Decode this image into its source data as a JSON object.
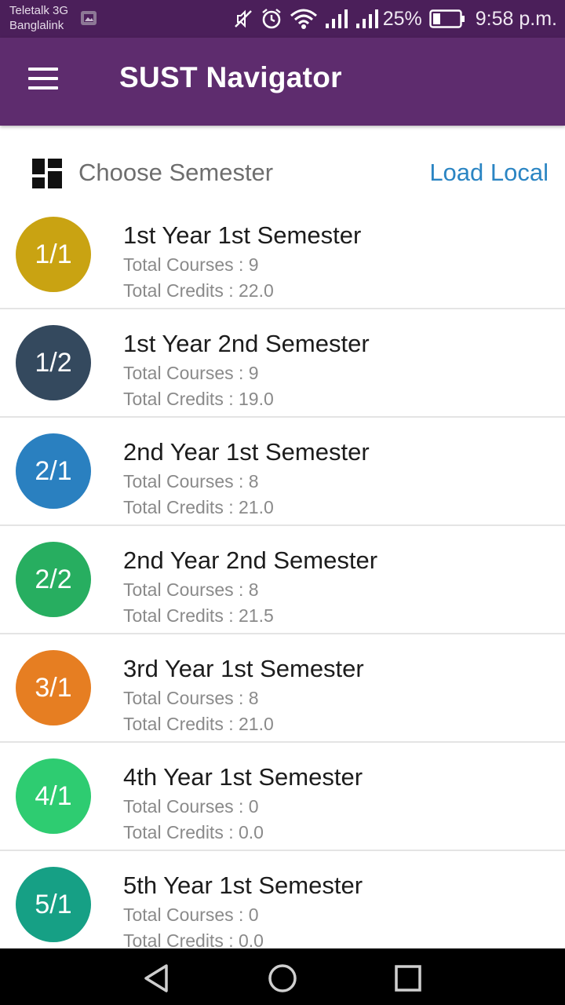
{
  "status_bar": {
    "carrier_1": "Teletalk 3G",
    "carrier_2": "Banglalink",
    "battery_percent": "25%",
    "time": "9:58 p.m.",
    "icons": [
      "gallery-icon",
      "mute-icon",
      "alarm-icon",
      "wifi-icon",
      "signal-icon",
      "signal-icon",
      "battery-icon"
    ]
  },
  "app_bar": {
    "title": "SUST Navigator",
    "background": "#5e2c6e",
    "menu_icon": "hamburger-menu-icon"
  },
  "header": {
    "icon": "dashboard-icon",
    "label": "Choose Semester",
    "action": "Load Local",
    "action_color": "#2b85c3"
  },
  "semesters": [
    {
      "badge": "1/1",
      "color": "#c9a312",
      "title": "1st Year 1st Semester",
      "courses": "Total Courses : 9",
      "credits": "Total Credits : 22.0"
    },
    {
      "badge": "1/2",
      "color": "#34495e",
      "title": "1st Year 2nd Semester",
      "courses": "Total Courses : 9",
      "credits": "Total Credits : 19.0"
    },
    {
      "badge": "2/1",
      "color": "#2a80c0",
      "title": "2nd Year 1st Semester",
      "courses": "Total Courses : 8",
      "credits": "Total Credits : 21.0"
    },
    {
      "badge": "2/2",
      "color": "#27ae60",
      "title": "2nd Year 2nd Semester",
      "courses": "Total Courses : 8",
      "credits": "Total Credits : 21.5"
    },
    {
      "badge": "3/1",
      "color": "#e67e22",
      "title": "3rd Year 1st Semester",
      "courses": "Total Courses : 8",
      "credits": "Total Credits : 21.0"
    },
    {
      "badge": "4/1",
      "color": "#2ecc71",
      "title": "4th Year 1st Semester",
      "courses": "Total Courses : 0",
      "credits": "Total Credits : 0.0"
    },
    {
      "badge": "5/1",
      "color": "#16a085",
      "title": "5th Year 1st Semester",
      "courses": "Total Courses : 0",
      "credits": "Total Credits : 0.0"
    }
  ],
  "nav_bar": {
    "back_icon": "back-triangle-icon",
    "home_icon": "home-circle-icon",
    "recents_icon": "recents-square-icon"
  }
}
